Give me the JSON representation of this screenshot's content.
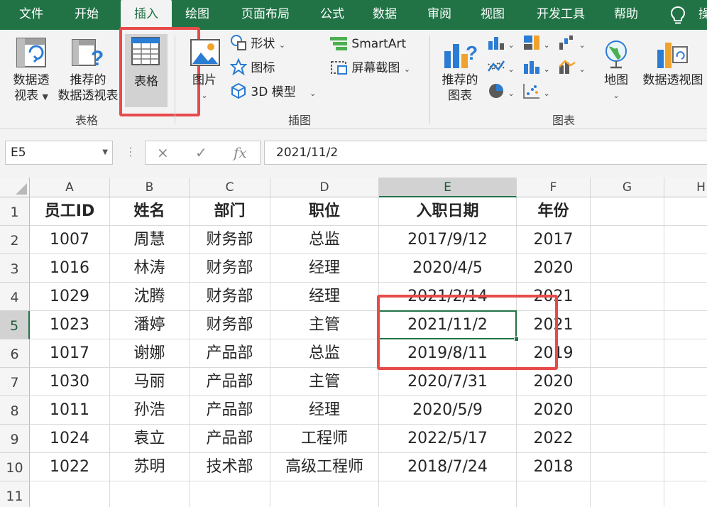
{
  "menu": {
    "tabs": [
      "文件",
      "开始",
      "插入",
      "绘图",
      "页面布局",
      "公式",
      "数据",
      "审阅",
      "视图",
      "开发工具",
      "帮助"
    ],
    "active": "插入",
    "tail_text": "操"
  },
  "ribbon": {
    "pivot_table": {
      "line1": "数据透",
      "line2": "视表"
    },
    "recommended_pivot": {
      "line1": "推荐的",
      "line2": "数据透视表"
    },
    "table": {
      "label": "表格"
    },
    "group_tables": "表格",
    "pictures": {
      "label": "图片"
    },
    "shapes": "形状",
    "icons": "图标",
    "model3d": "3D 模型",
    "smartart": "SmartArt",
    "screenshot": "屏幕截图",
    "group_illustrations": "插图",
    "recommended_charts": {
      "line1": "推荐的",
      "line2": "图表"
    },
    "maps": "地图",
    "pivot_chart": "数据透视图",
    "group_charts": "图表"
  },
  "formula_bar": {
    "name_box": "E5",
    "cancel_icon": "×",
    "enter_icon": "✓",
    "fx_label": "fx",
    "value": "2021/11/2"
  },
  "grid": {
    "columns": [
      "A",
      "B",
      "C",
      "D",
      "E",
      "F",
      "G",
      "H"
    ],
    "rows": [
      "1",
      "2",
      "3",
      "4",
      "5",
      "6",
      "7",
      "8",
      "9",
      "10",
      "11"
    ],
    "selected_cell": "E5",
    "data": [
      [
        "员工ID",
        "姓名",
        "部门",
        "职位",
        "入职日期",
        "年份"
      ],
      [
        "1007",
        "周慧",
        "财务部",
        "总监",
        "2017/9/12",
        "2017"
      ],
      [
        "1016",
        "林涛",
        "财务部",
        "经理",
        "2020/4/5",
        "2020"
      ],
      [
        "1029",
        "沈腾",
        "财务部",
        "经理",
        "2021/2/14",
        "2021"
      ],
      [
        "1023",
        "潘婷",
        "财务部",
        "主管",
        "2021/11/2",
        "2021"
      ],
      [
        "1017",
        "谢娜",
        "产品部",
        "总监",
        "2019/8/11",
        "2019"
      ],
      [
        "1030",
        "马丽",
        "产品部",
        "主管",
        "2020/7/31",
        "2020"
      ],
      [
        "1011",
        "孙浩",
        "产品部",
        "经理",
        "2020/5/9",
        "2020"
      ],
      [
        "1024",
        "袁立",
        "产品部",
        "工程师",
        "2022/5/17",
        "2022"
      ],
      [
        "1022",
        "苏明",
        "技术部",
        "高级工程师",
        "2018/7/24",
        "2018"
      ]
    ]
  },
  "colors": {
    "excel_green": "#217346",
    "highlight_red": "#e84a4a"
  }
}
